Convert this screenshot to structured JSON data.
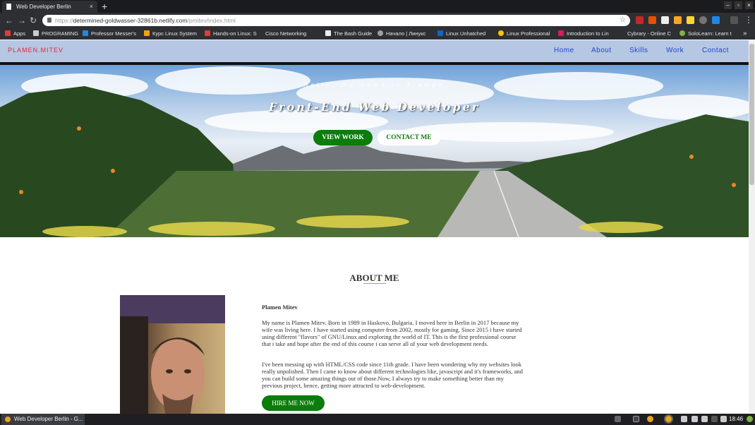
{
  "browser": {
    "tab_title": "Web Developer Berlin",
    "tab_close": "×",
    "new_tab": "+",
    "url_prefix": "https://",
    "url_host": "determined-goldwasser-32861b.netlify.com",
    "url_path": "/pmitev/index.html",
    "bookmarks": [
      {
        "label": "Apps",
        "color": "#e53935"
      },
      {
        "label": "PROGRAMING",
        "color": "#cccccc"
      },
      {
        "label": "Professor Messer's",
        "color": "#1e88e5"
      },
      {
        "label": "Курс Linux System",
        "color": "#f4a300"
      },
      {
        "label": "Hands-on Linux: S",
        "color": "#e53935"
      },
      {
        "label": "Cisco Networking",
        "color": "#2e2f33"
      },
      {
        "label": "The Bash Guide",
        "color": "#eeeeee"
      },
      {
        "label": "Начало | Линукс",
        "color": "#9e9e9e"
      },
      {
        "label": "Linux Unhatched",
        "color": "#1565c0"
      },
      {
        "label": "Linux Professional",
        "color": "#f9c300"
      },
      {
        "label": "Introduction to Lin",
        "color": "#d81b60"
      },
      {
        "label": "Cybrary - Online C",
        "color": "#2e2f33"
      },
      {
        "label": "SoloLearn: Learn t",
        "color": "#7cb342"
      }
    ],
    "more": "»"
  },
  "site": {
    "logo": "PLAMEN.MITEV",
    "menu": [
      "Home",
      "About",
      "Skills",
      "Work",
      "Contact"
    ],
    "hero": {
      "greeting": "Hello, my name is Plamen",
      "title": "Front-End Web Developer",
      "btn_work": "VIEW WORK",
      "btn_contact": "CONTACT ME"
    },
    "about": {
      "heading": "ABOUT ME",
      "name": "Plamen Mitev",
      "p1": "My name is Plamen Mitev. Born in 1989 in Haskovo, Bulgaria. I moved here in Berlin in 2017 because my wife was living here. I have started using computer from 2002, mostly for gaming. Since 2015 i have started using different \"flavors\" of GNU/Linux and exploring the world of IT. This is the first professional course that i take and hope after the end of this course i can serve all of your web development needs.",
      "p2": "I've been messing up with HTML/CSS code since 11th grade. I have been wondering why my websites look really unpolished. Then I came to know about different technologies like, javascript and it's frameworks, and you can build some amazing things out of those.Now, I always try to make something better than my previous project, hence, getting more attracted to web-development.",
      "hire": "HIRE ME NOW"
    }
  },
  "taskbar": {
    "task": "Web Developer Berlin - G...",
    "time": "18:46"
  },
  "colors": {
    "nav_bg": "#b5c7e3",
    "logo": "#e0263d",
    "menu": "#2544c8",
    "accent_green": "#0a7d0a"
  }
}
